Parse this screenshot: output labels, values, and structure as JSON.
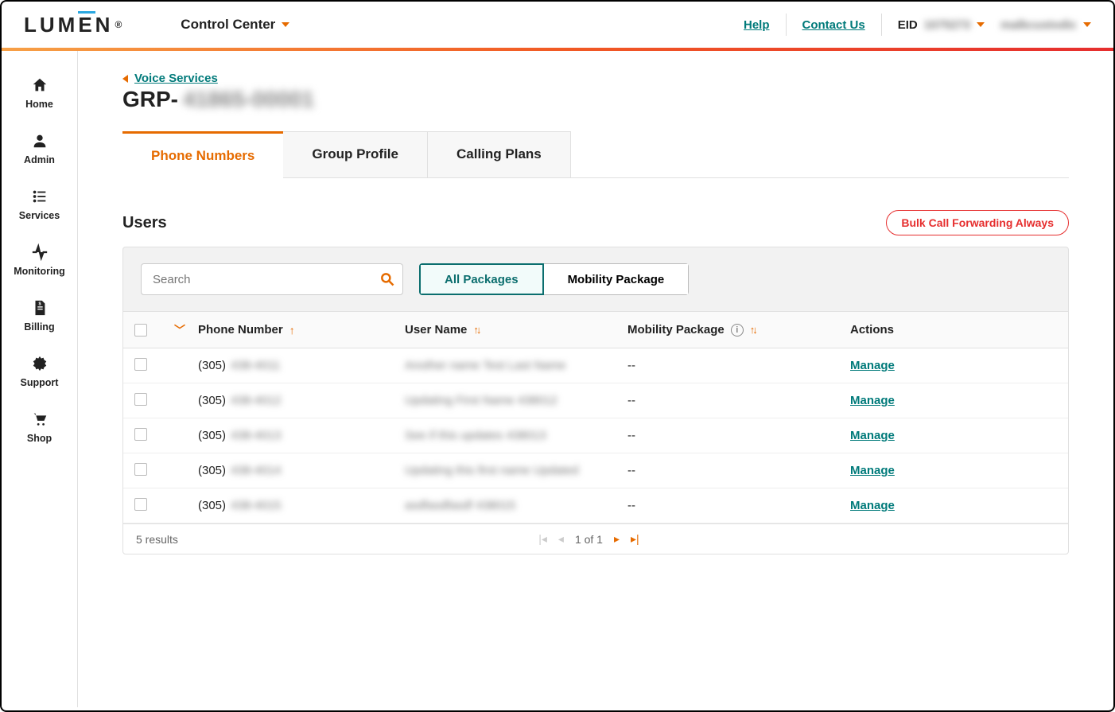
{
  "brand": {
    "logo_pre": "LUM",
    "logo_e": "E",
    "logo_post": "N",
    "reg": "®"
  },
  "topbar": {
    "portal_name": "Control Center",
    "help": "Help",
    "contact": "Contact Us",
    "eid_label": "EID",
    "eid_value": "1075273",
    "user_name": "malkcustodic"
  },
  "sidebar": {
    "items": [
      {
        "label": "Home"
      },
      {
        "label": "Admin"
      },
      {
        "label": "Services"
      },
      {
        "label": "Monitoring"
      },
      {
        "label": "Billing"
      },
      {
        "label": "Support"
      },
      {
        "label": "Shop"
      }
    ]
  },
  "breadcrumb": {
    "parent": "Voice Services"
  },
  "page": {
    "title_prefix": "GRP-",
    "title_blur": "41865-00001"
  },
  "tabs": [
    {
      "label": "Phone Numbers",
      "active": true
    },
    {
      "label": "Group Profile",
      "active": false
    },
    {
      "label": "Calling Plans",
      "active": false
    }
  ],
  "section": {
    "title": "Users",
    "bulk_btn": "Bulk Call Forwarding Always"
  },
  "toolbar": {
    "search_placeholder": "Search",
    "filters": [
      {
        "label": "All Packages",
        "active": true
      },
      {
        "label": "Mobility Package",
        "active": false
      }
    ]
  },
  "table": {
    "columns": {
      "phone": "Phone Number",
      "user": "User Name",
      "package": "Mobility Package",
      "actions": "Actions"
    },
    "rows": [
      {
        "phone_prefix": "(305)",
        "phone_blur": "438-4011",
        "user_blur": "Another name Test Last Name",
        "package": "--",
        "action": "Manage"
      },
      {
        "phone_prefix": "(305)",
        "phone_blur": "438-4012",
        "user_blur": "Updating First Name 438012",
        "package": "--",
        "action": "Manage"
      },
      {
        "phone_prefix": "(305)",
        "phone_blur": "438-4013",
        "user_blur": "See if this updates 438013",
        "package": "--",
        "action": "Manage"
      },
      {
        "phone_prefix": "(305)",
        "phone_blur": "438-4014",
        "user_blur": "Updating this first name Updated",
        "package": "--",
        "action": "Manage"
      },
      {
        "phone_prefix": "(305)",
        "phone_blur": "438-4015",
        "user_blur": "asdfasdfasdf 438015",
        "package": "--",
        "action": "Manage"
      }
    ],
    "results_text": "5 results",
    "pager": "1 of 1"
  }
}
